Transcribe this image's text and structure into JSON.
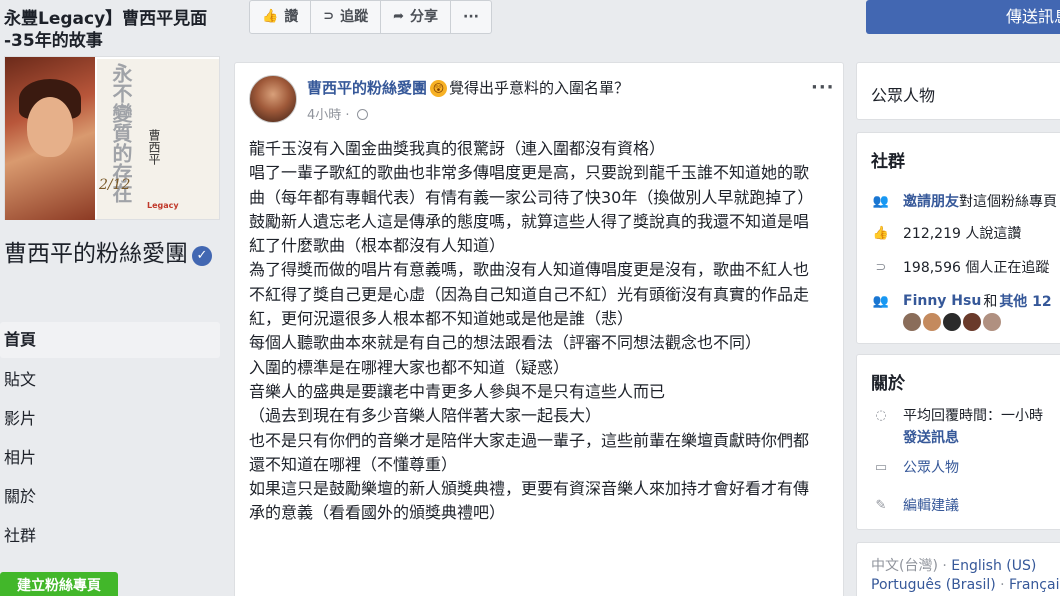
{
  "promo": {
    "title_line1": "永豐Legacy】曹西平見面",
    "title_line2": "-35年的故事",
    "album_title": "永不變質的存在",
    "album_artist": "曹西平",
    "album_date": "2/12",
    "album_logo": "Legacy"
  },
  "page": {
    "name": "曹西平的粉絲愛團"
  },
  "left_nav": {
    "items": [
      {
        "label": "首頁"
      },
      {
        "label": "貼文"
      },
      {
        "label": "影片"
      },
      {
        "label": "相片"
      },
      {
        "label": "關於"
      },
      {
        "label": "社群"
      }
    ],
    "create_page": "建立粉絲專頁"
  },
  "action_bar": {
    "like": "讚",
    "follow": "追蹤",
    "share": "分享",
    "more": "···"
  },
  "send_message": "傳送訊息",
  "post": {
    "author": "曹西平的粉絲愛團",
    "feeling": "覺得出乎意料的入圍名單？",
    "time": "4小時",
    "menu": "···",
    "body": [
      "龍千玉沒有入圍金曲獎我真的很驚訝（連入圍都沒有資格）",
      "唱了一輩子歌紅的歌曲也非常多傳唱度更是高，只要說到龍千玉誰不知道她的歌曲（每年都有專輯代表）有情有義一家公司待了快30年（換做別人早就跑掉了）",
      "鼓勵新人遺忘老人這是傳承的態度嗎，就算這些人得了獎說真的我還不知道是唱紅了什麼歌曲（根本都沒有人知道）",
      "為了得獎而做的唱片有意義嗎，歌曲沒有人知道傳唱度更是沒有，歌曲不紅人也不紅得了獎自己更是心虛（因為自己知道自己不紅）光有頭銜沒有真實的作品走紅，更何況還很多人根本都不知道她或是他是誰（悲）",
      "每個人聽歌曲本來就是有自己的想法跟看法（評審不同想法觀念也不同）",
      "入圍的標準是在哪裡大家也都不知道（疑惑）",
      "音樂人的盛典是要讓老中青更多人參與不是只有這些人而已",
      "（過去到現在有多少音樂人陪伴著大家一起長大）",
      "也不是只有你們的音樂才是陪伴大家走過一輩子，這些前輩在樂壇貢獻時你們都還不知道在哪裡（不懂尊重）",
      "如果這只是鼓勵樂壇的新人頒獎典禮，更要有資深音樂人來加持才會好看才有傳承的意義（看看國外的頒獎典禮吧）"
    ]
  },
  "right": {
    "category": "公眾人物",
    "community": {
      "title": "社群",
      "invite_link": "邀請朋友",
      "invite_rest": "對這個粉絲專頁",
      "likes": "212,219 人說這讚",
      "follows": "198,596 個人正在追蹤",
      "friends_link": "Finny Hsu",
      "friends_and": "和",
      "friends_more": "其他 12"
    },
    "about": {
      "title": "關於",
      "response": "平均回覆時間：一小時",
      "send_msg": "發送訊息",
      "category": "公眾人物",
      "edit": "編輯建議"
    },
    "languages": {
      "current": "中文(台灣)",
      "sep": " · ",
      "l1": "English (US)",
      "l2": "Português (Brasil)",
      "l3": "Françai"
    }
  },
  "colors": {
    "fb_blue": "#4267b2",
    "link": "#365899",
    "bg": "#e9ebee",
    "green": "#42b72a"
  }
}
